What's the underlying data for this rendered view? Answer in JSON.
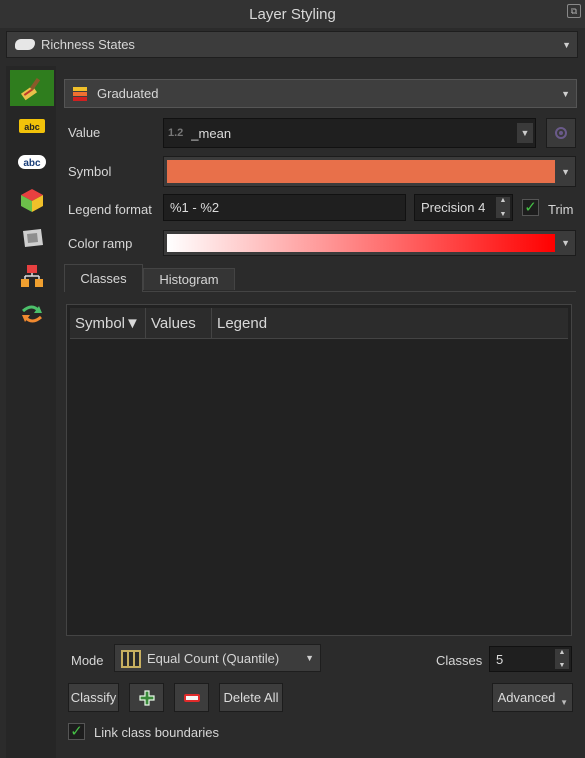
{
  "window": {
    "title": "Layer Styling"
  },
  "layer_selector": {
    "value": "Richness States"
  },
  "sidebar": {
    "tabs": [
      {
        "name": "symbology-tab-icon"
      },
      {
        "name": "labels-tab-icon"
      },
      {
        "name": "label-style-tab-icon"
      },
      {
        "name": "3d-view-tab-icon"
      },
      {
        "name": "rendering-tab-icon"
      },
      {
        "name": "diagram-tab-icon"
      },
      {
        "name": "history-tab-icon"
      }
    ]
  },
  "renderer": {
    "value": "Graduated"
  },
  "value_field": {
    "label": "Value",
    "type_hint": "1.2",
    "value": "_mean"
  },
  "symbol": {
    "label": "Symbol",
    "color": "#e8704a"
  },
  "legend_format": {
    "label": "Legend format",
    "value": "%1 - %2",
    "precision": "Precision 4",
    "trim_label": "Trim",
    "trim_checked": true
  },
  "color_ramp": {
    "label": "Color ramp",
    "from": "#ffffff",
    "to": "#ff0000"
  },
  "tabs": {
    "classes": "Classes",
    "histogram": "Histogram"
  },
  "table": {
    "headers": [
      "Symbol▼",
      "Values",
      "Legend"
    ]
  },
  "mode": {
    "label": "Mode",
    "value": "Equal Count (Quantile)"
  },
  "classes": {
    "label": "Classes",
    "value": "5"
  },
  "buttons": {
    "classify": "Classify",
    "delete_all": "Delete All",
    "advanced": "Advanced"
  },
  "link_boundaries": {
    "label": "Link class boundaries",
    "checked": true
  }
}
